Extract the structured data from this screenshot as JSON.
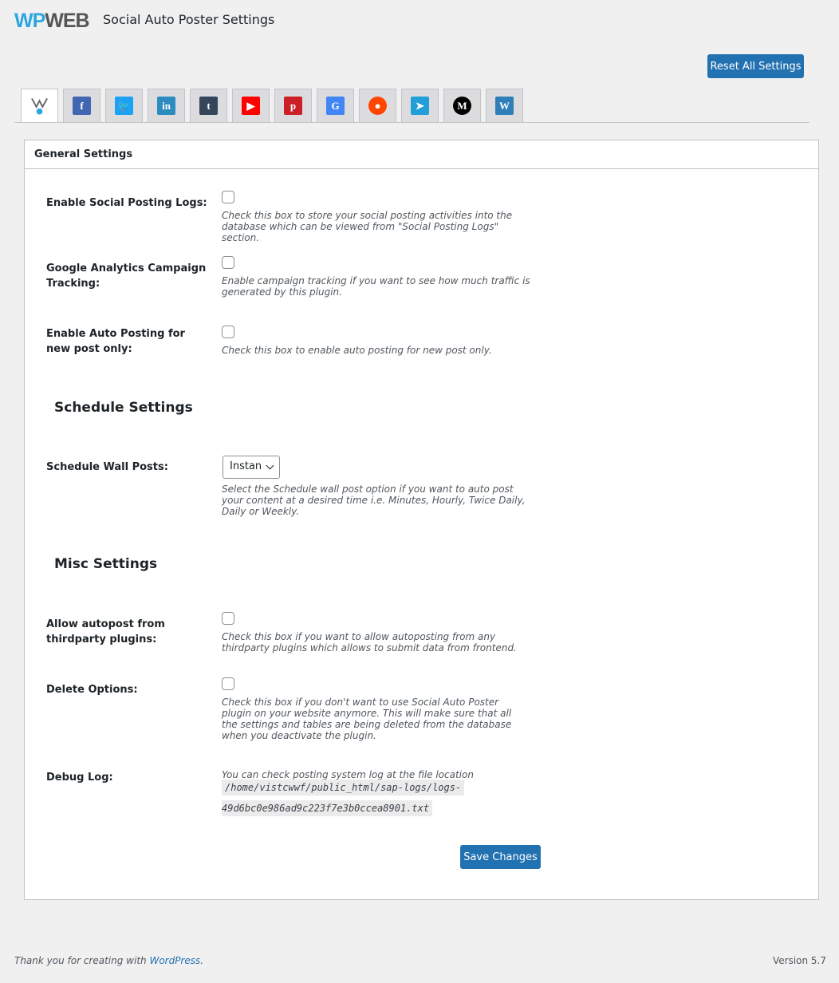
{
  "header": {
    "logo_wp": "WP",
    "logo_web": "WEB",
    "title": "Social Auto Poster Settings",
    "reset_label": "Reset All Settings"
  },
  "tabs": [
    {
      "name": "general",
      "icon": "wpweb-icon",
      "active": true
    },
    {
      "name": "facebook",
      "icon": "facebook-icon",
      "glyph": "f",
      "color": "#4267b2"
    },
    {
      "name": "twitter",
      "icon": "twitter-icon",
      "glyph": "🐦",
      "color": "#1da1f2"
    },
    {
      "name": "linkedin",
      "icon": "linkedin-icon",
      "glyph": "in",
      "color": "#2e8bc0"
    },
    {
      "name": "tumblr",
      "icon": "tumblr-icon",
      "glyph": "t",
      "color": "#35465c"
    },
    {
      "name": "youtube",
      "icon": "youtube-icon",
      "glyph": "▶",
      "color": "#ff0000"
    },
    {
      "name": "pinterest",
      "icon": "pinterest-icon",
      "glyph": "p",
      "color": "#cb2027"
    },
    {
      "name": "google-business",
      "icon": "google-my-business-icon",
      "glyph": "G",
      "color": "#4285f4"
    },
    {
      "name": "reddit",
      "icon": "reddit-icon",
      "glyph": "●",
      "color": "#ff4500"
    },
    {
      "name": "telegram",
      "icon": "telegram-icon",
      "glyph": "➤",
      "color": "#229ed9"
    },
    {
      "name": "medium",
      "icon": "medium-icon",
      "glyph": "M",
      "color": "#000000"
    },
    {
      "name": "wordpress",
      "icon": "wordpress-icon",
      "glyph": "W",
      "color": "#2e7fb8"
    }
  ],
  "panel": {
    "title": "General Settings"
  },
  "general": [
    {
      "label": "Enable Social Posting Logs:",
      "desc": "Check this box to store your social posting activities into the database which can be viewed from \"Social Posting Logs\" section.",
      "checked": false
    },
    {
      "label": "Google Analytics Campaign Tracking:",
      "desc": "Enable campaign tracking if you want to see how much traffic is generated by this plugin.",
      "checked": false
    },
    {
      "label": "Enable Auto Posting for new post only:",
      "desc": "Check this box to enable auto posting for new post only.",
      "checked": false
    }
  ],
  "schedule": {
    "heading": "Schedule Settings",
    "label": "Schedule Wall Posts:",
    "value": "Instant",
    "desc": "Select the Schedule wall post option if you want to auto post your content at a desired time i.e. Minutes, Hourly, Twice Daily, Daily or Weekly."
  },
  "misc": {
    "heading": "Misc Settings",
    "items": [
      {
        "label": "Allow autopost from thirdparty plugins:",
        "desc": "Check this box if you want to allow autoposting from any thirdparty plugins which allows to submit data from frontend.",
        "checked": false
      },
      {
        "label": "Delete Options:",
        "desc": "Check this box if you don't want to use Social Auto Poster plugin on your website anymore. This will make sure that all the settings and tables are being deleted from the database when you deactivate the plugin.",
        "checked": false
      }
    ],
    "debug_label": "Debug Log:",
    "debug_desc": "You can check posting system log at the file location",
    "debug_path1": "/home/vistcwwf/public_html/sap-logs/logs-",
    "debug_path2": "49d6bc0e986ad9c223f7e3b0ccea8901.txt"
  },
  "save_label": "Save Changes",
  "footer": {
    "thanks_prefix": "Thank you for creating with ",
    "thanks_link": "WordPress",
    "thanks_suffix": ".",
    "version": "Version 5.7"
  }
}
